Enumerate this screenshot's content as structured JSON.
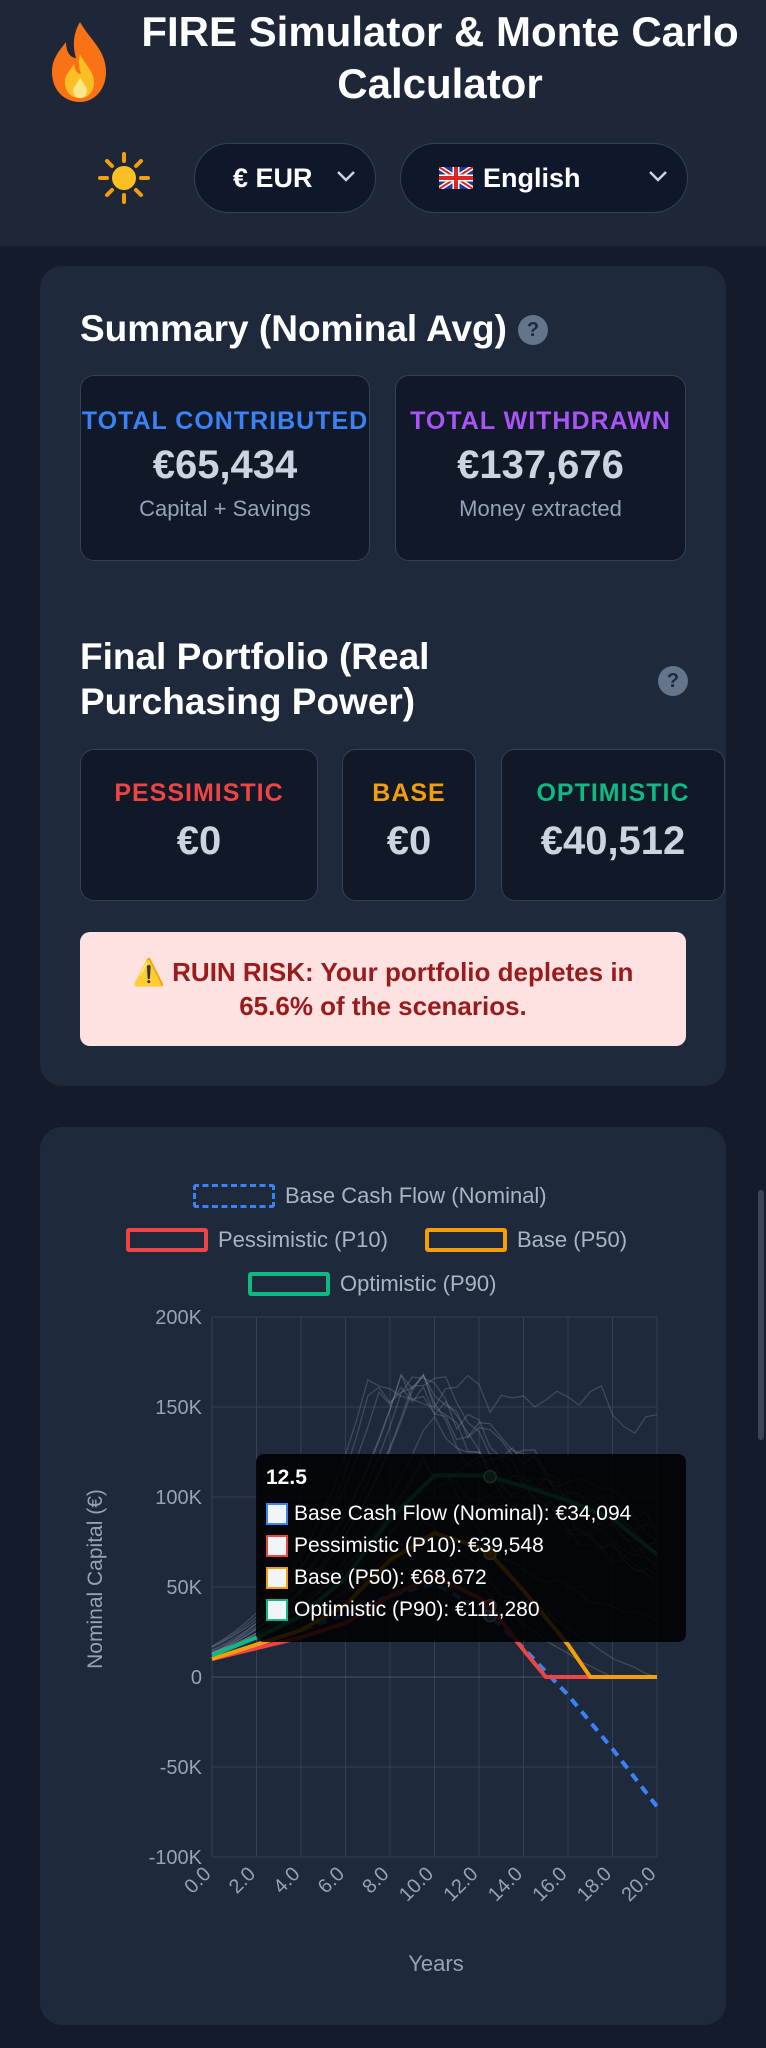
{
  "header": {
    "title": "FIRE Simulator & Monte Carlo Calculator",
    "logo_icon": "fire-icon",
    "theme_icon": "sun-icon",
    "currency_select": "€ EUR",
    "language_select": "English",
    "language_flag_icon": "uk-flag-icon"
  },
  "summary": {
    "title": "Summary (Nominal Avg)",
    "help": "?",
    "contributed": {
      "label": "TOTAL CONTRIBUTED",
      "value": "€65,434",
      "sub": "Capital + Savings",
      "color": "#3b82f6"
    },
    "withdrawn": {
      "label": "TOTAL WITHDRAWN",
      "value": "€137,676",
      "sub": "Money extracted",
      "color": "#a855f7"
    }
  },
  "final_portfolio": {
    "title": "Final Portfolio (Real Purchasing Power)",
    "help": "?",
    "pessimistic": {
      "label": "PESSIMISTIC",
      "value": "€0",
      "color": "#ef4444"
    },
    "base": {
      "label": "BASE",
      "value": "€0",
      "color": "#f59e0b"
    },
    "optimistic": {
      "label": "OPTIMISTIC",
      "value": "€40,512",
      "color": "#10b981"
    }
  },
  "alert": {
    "icon": "warning-icon",
    "text": "⚠️ RUIN RISK: Your portfolio depletes in 65.6% of the scenarios."
  },
  "chart_data": {
    "type": "line",
    "title": "",
    "xlabel": "Years",
    "ylabel": "Nominal Capital (€)",
    "xlim": [
      0,
      20
    ],
    "ylim": [
      -100000,
      200000
    ],
    "x_ticks": [
      "0.0",
      "2.0",
      "4.0",
      "6.0",
      "8.0",
      "10.0",
      "12.0",
      "14.0",
      "16.0",
      "18.0",
      "20.0"
    ],
    "y_ticks": [
      "200K",
      "150K",
      "100K",
      "50K",
      "0",
      "-50K",
      "-100K"
    ],
    "legend_position": "top",
    "series": [
      {
        "name": "Base Cash Flow (Nominal)",
        "color": "#3b82f6",
        "style": "dashed",
        "x": [
          0,
          2,
          4,
          6,
          8,
          10,
          12,
          12.5,
          14,
          16,
          18,
          20
        ],
        "values": [
          10000,
          18000,
          26000,
          35000,
          45000,
          52000,
          38000,
          34094,
          16000,
          -10000,
          -40000,
          -72000
        ]
      },
      {
        "name": "Pessimistic (P10)",
        "color": "#ef4444",
        "style": "solid",
        "x": [
          0,
          2,
          4,
          6,
          8,
          10,
          12,
          12.5,
          14,
          15,
          16,
          18,
          20
        ],
        "values": [
          10000,
          16000,
          22000,
          30000,
          45000,
          56000,
          44000,
          39548,
          15000,
          0,
          0,
          0,
          0
        ]
      },
      {
        "name": "Base (P50)",
        "color": "#f59e0b",
        "style": "solid",
        "x": [
          0,
          2,
          4,
          6,
          8,
          10,
          12,
          12.5,
          14,
          16,
          17,
          18,
          20
        ],
        "values": [
          10000,
          18000,
          26000,
          40000,
          65000,
          80000,
          72000,
          68672,
          48000,
          18000,
          0,
          0,
          0
        ]
      },
      {
        "name": "Optimistic (P90)",
        "color": "#10b981",
        "style": "solid",
        "x": [
          0,
          2,
          4,
          6,
          8,
          10,
          12,
          12.5,
          14,
          16,
          18,
          20
        ],
        "values": [
          12000,
          22000,
          34000,
          55000,
          88000,
          112000,
          112000,
          111280,
          106000,
          98000,
          88000,
          68000
        ]
      }
    ],
    "tooltip": {
      "title": "12.5",
      "rows": [
        {
          "label": "Base Cash Flow (Nominal): €34,094",
          "color": "#3b82f6"
        },
        {
          "label": "Pessimistic (P10): €39,548",
          "color": "#ef4444"
        },
        {
          "label": "Base (P50): €68,672",
          "color": "#f59e0b"
        },
        {
          "label": "Optimistic (P90): €111,280",
          "color": "#10b981"
        }
      ]
    }
  }
}
